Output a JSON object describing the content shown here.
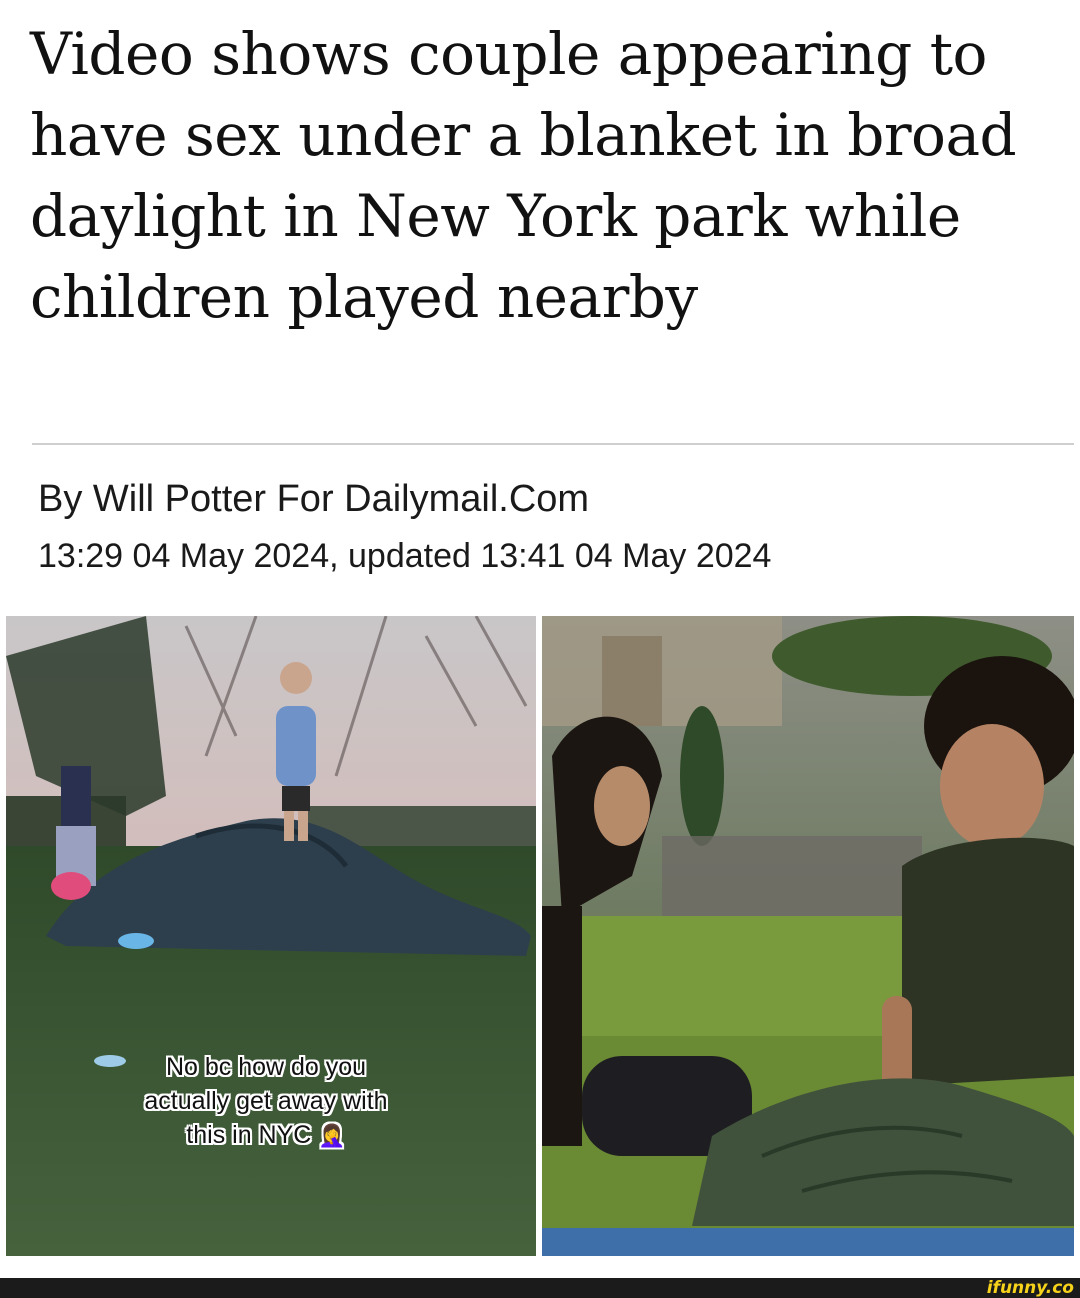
{
  "article": {
    "headline": "Video shows couple appearing to have sex under a blanket in broad daylight in New York park while children played nearby",
    "byline": "By Will Potter For Dailymail.Com",
    "dateline": "13:29 04 May 2024, updated 13:41 04 May 2024"
  },
  "photos": {
    "left": {
      "caption_lines": [
        "No bc how do you",
        "actually get away with",
        "this in NYC"
      ],
      "caption_emoji": "🤦‍♀️"
    }
  },
  "footer": {
    "watermark": "ifunny.co"
  },
  "colors": {
    "background": "#ffffff",
    "text": "#111111",
    "divider": "#cfcfcf",
    "watermark": "#f7d21a",
    "footer": "#1b1b1b"
  }
}
